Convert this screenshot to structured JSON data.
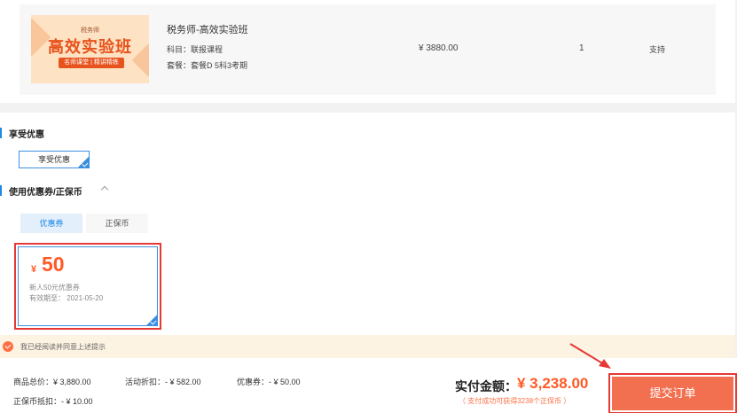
{
  "product": {
    "thumbnail": {
      "top_text": "税务师",
      "main_text": "高效实验班",
      "tag_text": "名师课堂 | 精讲精练"
    },
    "title": "税务师-高效实验班",
    "subject": "科目：联报课程",
    "package": "套餐：套餐D 5科3考期",
    "price": "¥ 3880.00",
    "quantity": "1",
    "support": "支持"
  },
  "discount": {
    "section_title": "享受优惠",
    "enjoy_button": "享受优惠"
  },
  "coupon_section": {
    "section_title": "使用优惠券/正保币",
    "tabs": [
      {
        "label": "优惠券",
        "active": true
      },
      {
        "label": "正保币",
        "active": false
      }
    ],
    "coupon": {
      "currency": "¥",
      "amount": "50",
      "name": "新人50元优惠券",
      "expiry": "有效期至： 2021-05-20"
    }
  },
  "notice": {
    "text": "我已经阅读并同意上述提示"
  },
  "summary": {
    "goods_total": "商品总价：¥ 3,880.00",
    "activity_discount": "活动折扣：- ¥ 582.00",
    "coupon_deduction": "优惠券：- ¥ 50.00",
    "coin_deduction": "正保币抵扣：- ¥ 10.00",
    "pay_label": "实付金额：",
    "pay_amount": "¥ 3,238.00",
    "pay_note": "（ 支付成功可获得3238个正保币 ）",
    "submit_label": "提交订单"
  },
  "colors": {
    "accent": "#ff5a26",
    "primary": "#1e88e5",
    "highlight": "#e53935",
    "submit": "#f26f4f"
  }
}
